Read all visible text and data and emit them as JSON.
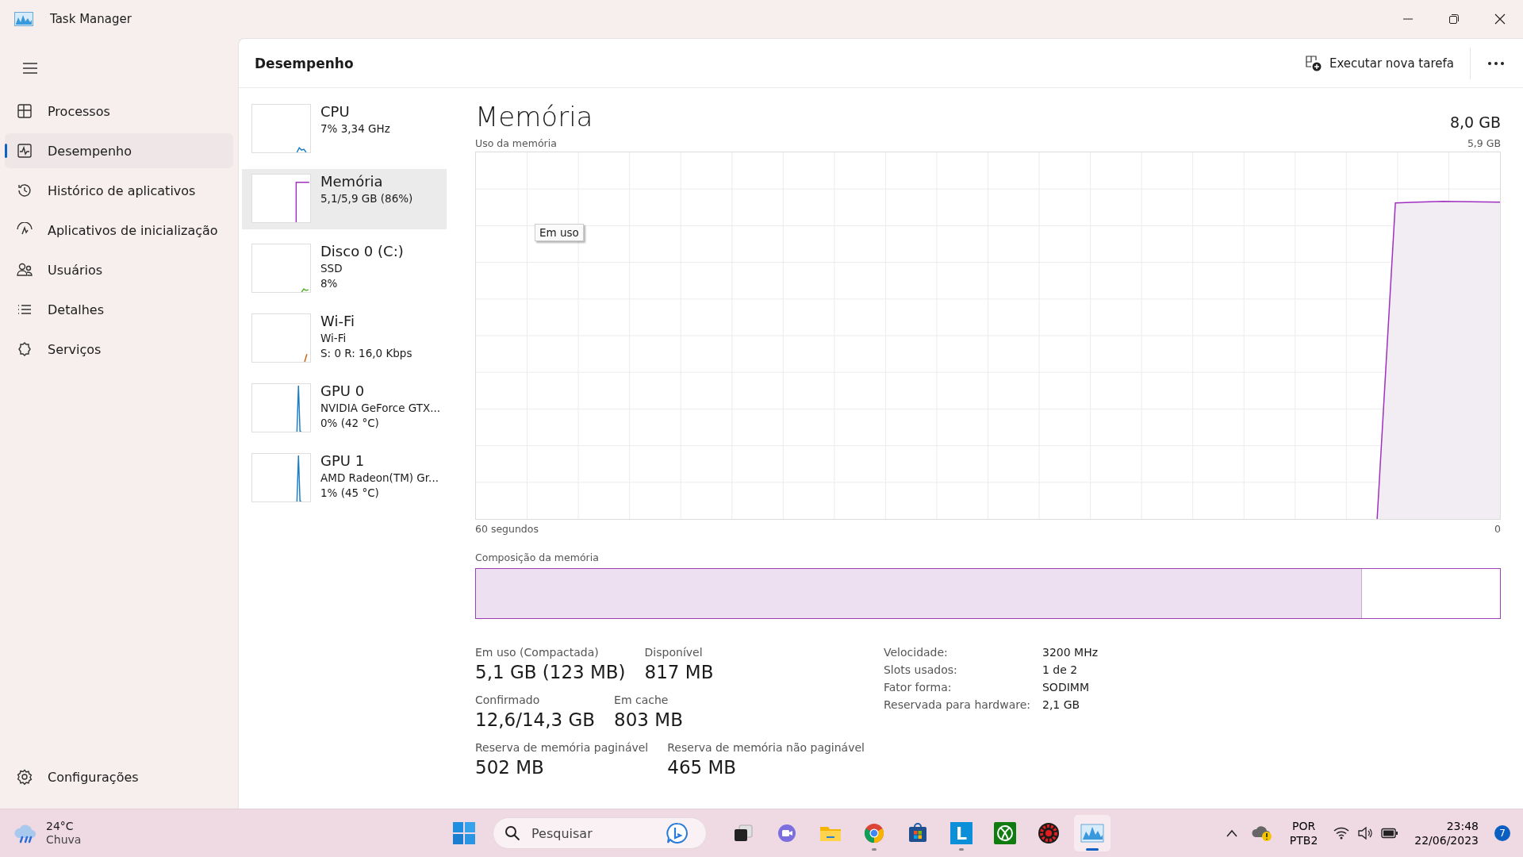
{
  "window": {
    "title": "Task Manager"
  },
  "sidebar": {
    "items": [
      {
        "label": "Processos",
        "kind": "processes",
        "selected": false
      },
      {
        "label": "Desempenho",
        "kind": "performance",
        "selected": true
      },
      {
        "label": "Histórico de aplicativos",
        "kind": "history",
        "selected": false
      },
      {
        "label": "Aplicativos de inicialização",
        "kind": "startup",
        "selected": false
      },
      {
        "label": "Usuários",
        "kind": "users",
        "selected": false
      },
      {
        "label": "Detalhes",
        "kind": "details",
        "selected": false
      },
      {
        "label": "Serviços",
        "kind": "services",
        "selected": false
      }
    ],
    "footer": {
      "label": "Configurações"
    }
  },
  "header": {
    "title": "Desempenho",
    "run_task": "Executar nova tarefa"
  },
  "devices": [
    {
      "name": "CPU",
      "details": [
        "7% 3,34 GHz"
      ],
      "kind": "cpu",
      "color": "#1a7dc4",
      "selected": false
    },
    {
      "name": "Memória",
      "details": [
        "5,1/5,9 GB (86%)"
      ],
      "kind": "memory",
      "color": "#a030c0",
      "selected": true
    },
    {
      "name": "Disco 0 (C:)",
      "details": [
        "SSD",
        "8%"
      ],
      "kind": "disk",
      "color": "#4caf20",
      "selected": false
    },
    {
      "name": "Wi-Fi",
      "details": [
        "Wi-Fi",
        "S: 0 R: 16,0 Kbps"
      ],
      "kind": "network",
      "color": "#c86414",
      "selected": false
    },
    {
      "name": "GPU 0",
      "details": [
        "NVIDIA GeForce GTX...",
        "0% (42 °C)"
      ],
      "kind": "gpu",
      "color": "#1a7dc4",
      "selected": false
    },
    {
      "name": "GPU 1",
      "details": [
        "AMD Radeon(TM) Gr...",
        "1% (45 °C)"
      ],
      "kind": "gpu",
      "color": "#1a7dc4",
      "selected": false
    }
  ],
  "detail": {
    "title": "Memória",
    "capacity": "8,0 GB",
    "graph_label": "Uso da memória",
    "graph_max": "5,9 GB",
    "tooltip": "Em uso",
    "time_span": "60 segundos",
    "time_end": "0",
    "composition_label": "Composição da memória",
    "composition": {
      "level": 0.865
    },
    "stats": [
      [
        {
          "label": "Em uso (Compactada)",
          "value": "5,1 GB (123 MB)"
        },
        {
          "label": "Disponível",
          "value": "817 MB"
        }
      ],
      [
        {
          "label": "Confirmado",
          "value": "12,6/14,3 GB"
        },
        {
          "label": "Em cache",
          "value": "803 MB"
        }
      ],
      [
        {
          "label": "Reserva de memória paginável",
          "value": "502 MB"
        },
        {
          "label": "Reserva de memória não paginável",
          "value": "465 MB"
        }
      ]
    ],
    "specs": [
      {
        "label": "Velocidade:",
        "value": "3200 MHz"
      },
      {
        "label": "Slots usados:",
        "value": "1 de 2"
      },
      {
        "label": "Fator forma:",
        "value": "SODIMM"
      },
      {
        "label": "Reservada para hardware:",
        "value": "2,1 GB"
      }
    ]
  },
  "taskbar": {
    "weather": {
      "temperature": "24°C",
      "condition": "Chuva"
    },
    "search": {
      "placeholder": "Pesquisar"
    },
    "apps": [
      {
        "kind": "taskview",
        "running": false,
        "active": false
      },
      {
        "kind": "chat",
        "running": false,
        "active": false
      },
      {
        "kind": "folder",
        "running": false,
        "active": false
      },
      {
        "kind": "browser",
        "running": true,
        "active": false
      },
      {
        "kind": "store",
        "running": false,
        "active": false
      },
      {
        "kind": "letter",
        "label": "L",
        "running": true,
        "active": false
      },
      {
        "kind": "xbox",
        "running": false,
        "active": false
      },
      {
        "kind": "gear",
        "running": false,
        "active": false
      },
      {
        "kind": "monitor",
        "running": true,
        "active": true
      }
    ],
    "tray": {
      "language": "POR",
      "layout": "PTB2",
      "time": "23:48",
      "date": "22/06/2023",
      "notifications": "7"
    }
  }
}
